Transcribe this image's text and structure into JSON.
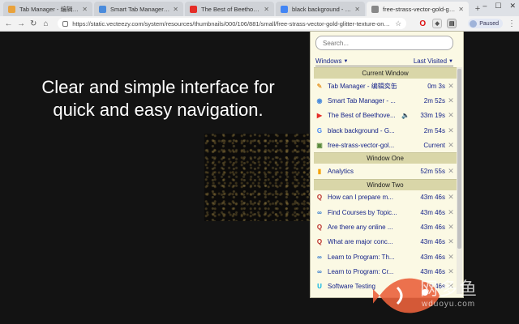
{
  "browser": {
    "tabs": [
      {
        "label": "Tab Manager - 编辑奕缶",
        "favicon": "note-icon",
        "color": "#e9a23b",
        "active": false
      },
      {
        "label": "Smart Tab Manager - Chrome",
        "favicon": "chrome-store-icon",
        "color": "#4a8bdc",
        "active": false
      },
      {
        "label": "The Best of Beethoven - Y",
        "favicon": "youtube-icon",
        "color": "#e52d27",
        "active": false
      },
      {
        "label": "black background - Google S",
        "favicon": "google-icon",
        "color": "#4285f4",
        "active": false
      },
      {
        "label": "free-strass-vector-gold-glitte",
        "favicon": "page-icon",
        "color": "#888888",
        "active": true
      }
    ],
    "url": "https://static.vecteezy.com/system/resources/thumbnails/000/106/881/small/free-strass-vector-gold-glitter-texture-on-black-backgrou",
    "paused_label": "Paused"
  },
  "page": {
    "hero_text": "Clear and simple interface for quick and easy navigation."
  },
  "popup": {
    "search_placeholder": "Search...",
    "sort_left": "Windows",
    "sort_right": "Last Visited",
    "sections": [
      {
        "title": "Current Window",
        "rows": [
          {
            "title": "Tab Manager - 编辑奕缶",
            "time": "0m 3s",
            "icon": "note-icon",
            "icon_color": "#e9a23b",
            "audio": false
          },
          {
            "title": "Smart Tab Manager - ...",
            "time": "2m 52s",
            "icon": "chrome-store-icon",
            "icon_color": "#4a8bdc",
            "audio": false
          },
          {
            "title": "The Best of Beethove...",
            "time": "33m 19s",
            "icon": "youtube-icon",
            "icon_color": "#e52d27",
            "audio": true
          },
          {
            "title": "black background - G...",
            "time": "2m 54s",
            "icon": "google-icon",
            "icon_color": "#4285f4",
            "audio": false
          },
          {
            "title": "free-strass-vector-gol...",
            "time": "Current",
            "icon": "page-icon",
            "icon_color": "#5a8a3c",
            "audio": false
          }
        ]
      },
      {
        "title": "Window One",
        "rows": [
          {
            "title": "Analytics",
            "time": "52m 55s",
            "icon": "analytics-icon",
            "icon_color": "#f4a20a",
            "audio": false
          }
        ]
      },
      {
        "title": "Window Two",
        "rows": [
          {
            "title": "How can I prepare m...",
            "time": "43m 46s",
            "icon": "quora-icon",
            "icon_color": "#b92b27",
            "audio": false
          },
          {
            "title": "Find Courses by Topic...",
            "time": "43m 46s",
            "icon": "coursera-icon",
            "icon_color": "#2a73cc",
            "audio": false
          },
          {
            "title": "Are there any online ...",
            "time": "43m 46s",
            "icon": "quora-icon",
            "icon_color": "#b92b27",
            "audio": false
          },
          {
            "title": "What are major conc...",
            "time": "43m 46s",
            "icon": "quora-icon",
            "icon_color": "#b92b27",
            "audio": false
          },
          {
            "title": "Learn to Program: Th...",
            "time": "43m 46s",
            "icon": "coursera-icon",
            "icon_color": "#2a73cc",
            "audio": false
          },
          {
            "title": "Learn to Program: Cr...",
            "time": "43m 46s",
            "icon": "coursera-icon",
            "icon_color": "#2a73cc",
            "audio": false
          },
          {
            "title": "Software Testing",
            "time": "43m 46s",
            "icon": "udacity-icon",
            "icon_color": "#02b3e4",
            "audio": false
          }
        ]
      }
    ]
  },
  "watermark": {
    "text": "网多鱼",
    "sub": "wduoyu.com"
  }
}
